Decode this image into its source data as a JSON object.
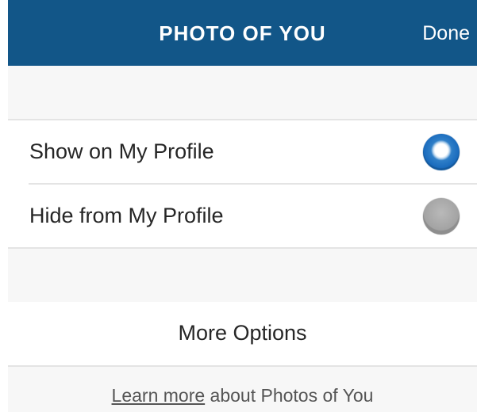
{
  "navbar": {
    "title": "PHOTO OF YOU",
    "done_label": "Done",
    "color": "#125688"
  },
  "options": [
    {
      "label": "Show on My Profile",
      "selected": true
    },
    {
      "label": "Hide from My Profile",
      "selected": false
    }
  ],
  "more_options_label": "More Options",
  "footer": {
    "link_text": "Learn more",
    "text": " about Photos of You"
  },
  "colors": {
    "accent": "#1a6bbd",
    "background_gap": "#f7f7f7",
    "text": "#262626"
  },
  "icons": {
    "selected_radio": "radio-selected-icon",
    "unselected_radio": "radio-unselected-icon"
  }
}
